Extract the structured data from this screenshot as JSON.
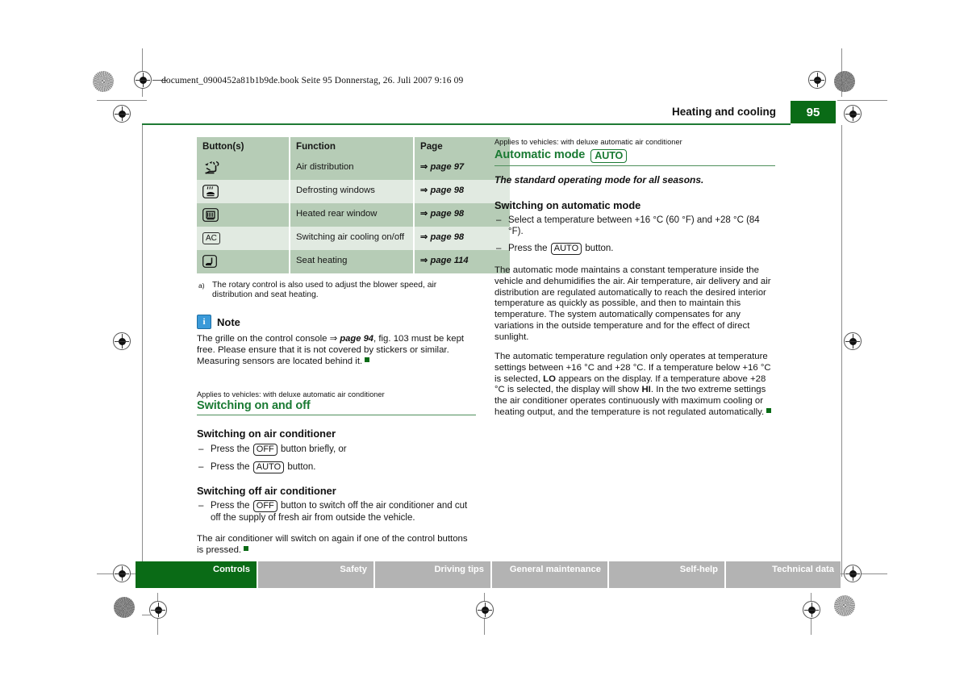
{
  "document_info": "document_0900452a81b1b9de.book  Seite 95  Donnerstag, 26. Juli 2007  9:16 09",
  "running_head": {
    "title": "Heating and cooling",
    "page_number": "95"
  },
  "colors": {
    "brand_green": "#0a6b16",
    "heading_green": "#1a7a33",
    "table_row_dark": "#b6ccb6",
    "table_row_light": "#e1eae1",
    "footer_inactive": "#b3b3b3",
    "note_icon_blue": "#3a9ad9"
  },
  "left_column": {
    "table": {
      "headers": [
        "Button(s)",
        "Function",
        "Page"
      ],
      "rows": [
        {
          "icon": "air-distribution-icon",
          "icon_label": "",
          "function": "Air distribution",
          "page": "page 97",
          "arrow": "⇒"
        },
        {
          "icon": "defrost-windshield-icon",
          "icon_label": "",
          "function": "Defrosting windows",
          "page": "page 98",
          "arrow": "⇒"
        },
        {
          "icon": "heated-rear-window-icon",
          "icon_label": "",
          "function": "Heated rear window",
          "page": "page 98",
          "arrow": "⇒"
        },
        {
          "icon": "ac-button-icon",
          "icon_label": "AC",
          "function": "Switching air cooling on/off",
          "page": "page 98",
          "arrow": "⇒"
        },
        {
          "icon": "seat-heating-icon",
          "icon_label": "",
          "function": "Seat heating",
          "page": "page 114",
          "arrow": "⇒"
        }
      ]
    },
    "footnote": {
      "marker": "a)",
      "text": "The rotary control is also used to adjust the blower speed, air distribution and seat heating."
    },
    "note": {
      "icon_letter": "i",
      "title": "Note",
      "text_part1": "The grille on the control console ",
      "arrow": "⇒",
      "ref": "page 94",
      "text_part2": ", fig. 103 must be kept free. Please ensure that it is not covered by stickers or similar. Measuring sensors are located behind it."
    },
    "section": {
      "applies": "Applies to vehicles: with deluxe automatic air conditioner",
      "heading": "Switching on and off",
      "sub1": "Switching on air conditioner",
      "list1": [
        {
          "pre": "Press the ",
          "key": "OFF",
          "post": " button briefly, or"
        },
        {
          "pre": "Press the ",
          "key": "AUTO",
          "post": " button."
        }
      ],
      "sub2": "Switching off air conditioner",
      "list2": [
        {
          "pre": "Press the ",
          "key": "OFF",
          "post": " button to switch off the air conditioner and cut off the supply of fresh air from outside the vehicle."
        }
      ],
      "closing": "The air conditioner will switch on again if one of the control buttons is pressed."
    }
  },
  "right_column": {
    "applies": "Applies to vehicles: with deluxe automatic air conditioner",
    "heading": "Automatic mode",
    "heading_key": "AUTO",
    "lead": "The standard operating mode for all seasons.",
    "sub1": "Switching on automatic mode",
    "list1": [
      {
        "pre": "Select a temperature between +16 °C (60 °F) and +28 °C (84 °F).",
        "key": "",
        "post": ""
      },
      {
        "pre": "Press the ",
        "key": "AUTO",
        "post": " button."
      }
    ],
    "para1": "The automatic mode maintains a constant temperature inside the vehicle and dehumidifies the air. Air temperature, air delivery and air distribution are regulated automatically to reach the desired interior temperature as quickly as possible, and then to maintain this temperature. The system automatically compensates for any variations in the outside temperature and for the effect of direct sunlight.",
    "para2": {
      "p1": "The automatic temperature regulation only operates at temperature settings between +16 °C and +28 °C. If a temperature below +16 °C is selected, ",
      "b1": "LO",
      "p2": " appears on the display. If a temperature above +28 °C is selected, the display will show ",
      "b2": "HI",
      "p3": ". In the two extreme settings the air conditioner operates continuously with maximum cooling or heating output, and the temperature is not regulated automatically."
    }
  },
  "footer_tabs": [
    {
      "label": "Controls",
      "active": true
    },
    {
      "label": "Safety",
      "active": false
    },
    {
      "label": "Driving tips",
      "active": false
    },
    {
      "label": "General maintenance",
      "active": false
    },
    {
      "label": "Self-help",
      "active": false
    },
    {
      "label": "Technical data",
      "active": false
    }
  ]
}
